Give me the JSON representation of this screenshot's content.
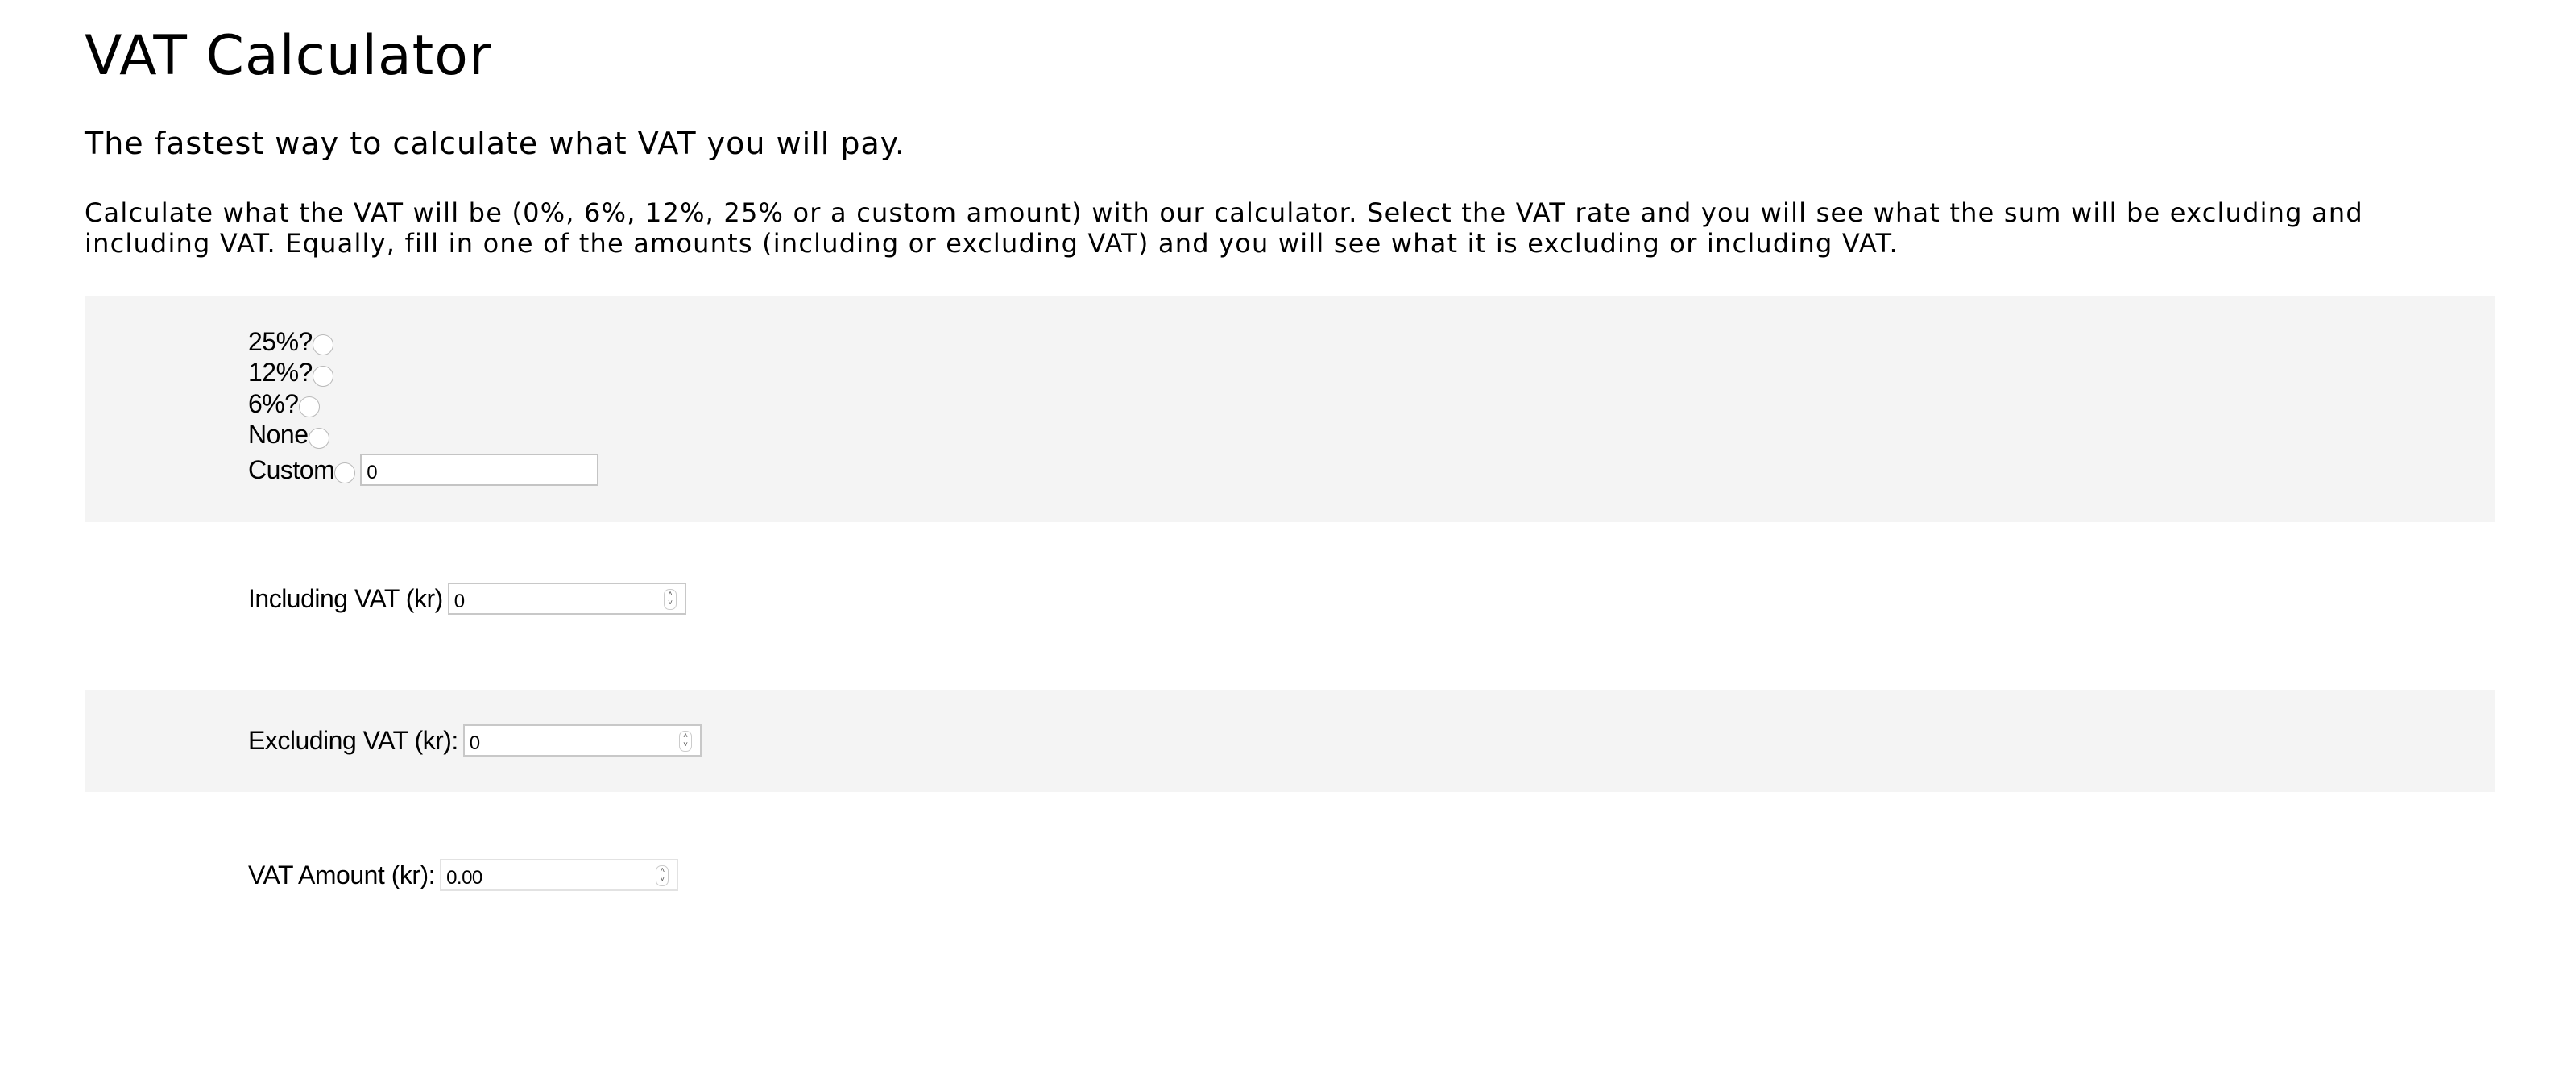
{
  "header": {
    "title": "VAT Calculator",
    "subtitle": "The fastest way to calculate what VAT you will pay.",
    "description": "Calculate what the VAT will be (0%, 6%, 12%, 25% or a custom amount) with our calculator. Select the VAT rate and you will see what the sum will be excluding and including VAT. Equally, fill in one of the amounts (including or excluding VAT) and you will see what it is excluding or including VAT."
  },
  "rates": {
    "options": [
      {
        "label": "25%?"
      },
      {
        "label": "12%?"
      },
      {
        "label": "6%?"
      },
      {
        "label": "None"
      },
      {
        "label": "Custom"
      }
    ],
    "custom_value": "0"
  },
  "fields": {
    "including": {
      "label": "Including VAT (kr)",
      "value": "0"
    },
    "excluding": {
      "label": "Excluding VAT (kr):",
      "value": "0"
    },
    "vat_amount": {
      "label": "VAT Amount (kr):",
      "value": "0.00"
    }
  },
  "colors": {
    "band": "#f4f4f4"
  }
}
